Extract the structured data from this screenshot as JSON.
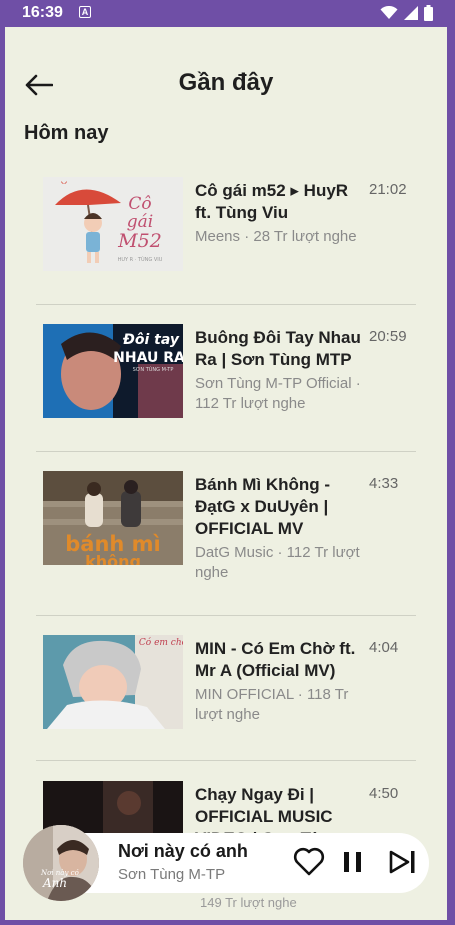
{
  "status_bar": {
    "time": "16:39",
    "notification_letter": "A",
    "icons": [
      "wifi-icon",
      "signal-icon",
      "battery-icon"
    ]
  },
  "header": {
    "title": "Gần đây",
    "back_icon": "arrow-left-icon"
  },
  "section": {
    "title": "Hôm nay"
  },
  "songs": [
    {
      "title": "Cô gái m52 ▸ HuyR ft. Tùng Viu",
      "meta": "Meens · 28 Tr lượt nghe",
      "duration": "21:02",
      "thumb_text": "Cô gái M52",
      "thumb_sub": "HUY R · TÙNG VIU"
    },
    {
      "title": "Buông Đôi Tay Nhau Ra | Sơn Tùng MTP",
      "meta": "Sơn Tùng M-TP Official · 112 Tr lượt nghe",
      "duration": "20:59",
      "thumb_text": "Đôi tay NHAU RA",
      "thumb_sub": "SƠN TÙNG M-TP"
    },
    {
      "title": "Bánh Mì Không - ĐạtG x DuUyên | OFFICIAL MV",
      "meta": "DatG Music · 112 Tr lượt nghe",
      "duration": "4:33",
      "thumb_text": "bánh mì không"
    },
    {
      "title": "MIN - Có Em Chờ ft. Mr A (Official MV)",
      "meta": "MIN OFFICIAL · 118 Tr lượt nghe",
      "duration": "4:04",
      "thumb_text": "Có em chờ"
    },
    {
      "title": "Chạy Ngay Đi | OFFICIAL MUSIC VIDEO | Sơn Tùng",
      "meta": "149 Tr lượt nghe",
      "duration": "4:50"
    }
  ],
  "mini_player": {
    "title": "Nơi này có anh",
    "artist": "Sơn Tùng M-TP",
    "cover_text": "Nơi này có Anh",
    "icons": [
      "heart-icon",
      "pause-icon",
      "skip-next-icon"
    ]
  },
  "colors": {
    "status_bar": "#6f4fa6",
    "background": "#eef0e2",
    "player": "#ffffff"
  }
}
